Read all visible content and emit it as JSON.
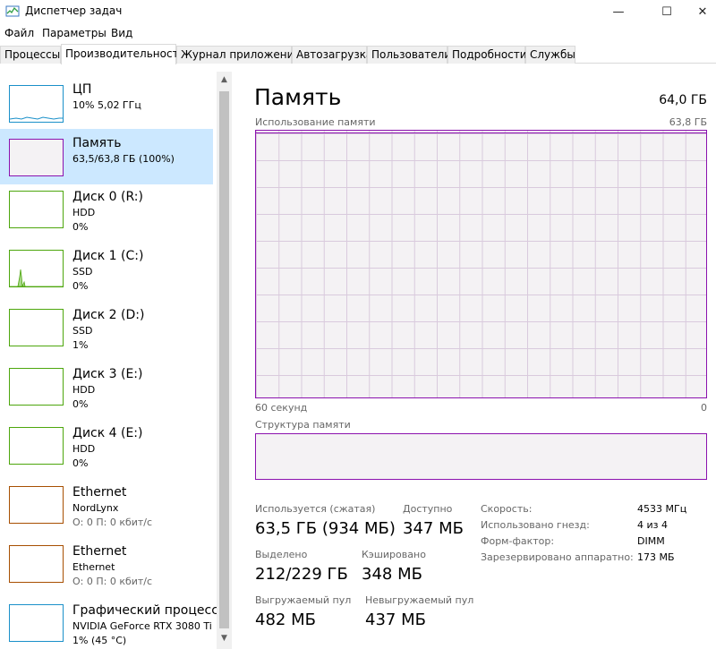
{
  "window": {
    "title": "Диспетчер задач",
    "controls": {
      "minimize": "—",
      "maximize": "☐",
      "close": "✕"
    }
  },
  "menu": [
    "Файл",
    "Параметры",
    "Вид"
  ],
  "tabs": [
    {
      "label": "Процессы",
      "active": false
    },
    {
      "label": "Производительность",
      "active": true
    },
    {
      "label": "Журнал приложений",
      "active": false
    },
    {
      "label": "Автозагрузка",
      "active": false
    },
    {
      "label": "Пользователи",
      "active": false
    },
    {
      "label": "Подробности",
      "active": false
    },
    {
      "label": "Службы",
      "active": false
    }
  ],
  "sidebar": {
    "items": [
      {
        "name": "ЦП",
        "line1": "10%  5,02 ГГц",
        "line2": "",
        "color": "#1a90c9",
        "selected": false
      },
      {
        "name": "Память",
        "line1": "63,5/63,8 ГБ (100%)",
        "line2": "",
        "color": "#8b12ae",
        "selected": true
      },
      {
        "name": "Диск 0 (R:)",
        "line1": "HDD",
        "line2": "0%",
        "color": "#4da60c",
        "selected": false
      },
      {
        "name": "Диск 1 (C:)",
        "line1": "SSD",
        "line2": "0%",
        "color": "#4da60c",
        "selected": false
      },
      {
        "name": "Диск 2 (D:)",
        "line1": "SSD",
        "line2": "1%",
        "color": "#4da60c",
        "selected": false
      },
      {
        "name": "Диск 3 (E:)",
        "line1": "HDD",
        "line2": "0%",
        "color": "#4da60c",
        "selected": false
      },
      {
        "name": "Диск 4 (E:)",
        "line1": "HDD",
        "line2": "0%",
        "color": "#4da60c",
        "selected": false
      },
      {
        "name": "Ethernet",
        "line1": "NordLynx",
        "line2": "О: 0 П: 0 кбит/с",
        "color": "#a74f01",
        "selected": false
      },
      {
        "name": "Ethernet",
        "line1": "Ethernet",
        "line2": "О: 0 П: 0 кбит/с",
        "color": "#a74f01",
        "selected": false
      },
      {
        "name": "Графический процессор",
        "line1": "NVIDIA GeForce RTX 3080 Ti",
        "line2": "1% (45 °C)",
        "color": "#1a90c9",
        "selected": false
      }
    ]
  },
  "main": {
    "title": "Память",
    "total": "64,0 ГБ",
    "usage_label": "Использование памяти",
    "usage_max": "63,8 ГБ",
    "time_left": "60 секунд",
    "time_right": "0",
    "structure_label": "Структура памяти",
    "accent": "#8b12ae",
    "stats": {
      "in_use_label": "Используется (сжатая)",
      "in_use_value": "63,5 ГБ (934 МБ)",
      "available_label": "Доступно",
      "available_value": "347 МБ",
      "committed_label": "Выделено",
      "committed_value": "212/229 ГБ",
      "cached_label": "Кэшировано",
      "cached_value": "348 МБ",
      "paged_label": "Выгружаемый пул",
      "paged_value": "482 МБ",
      "nonpaged_label": "Невыгружаемый пул",
      "nonpaged_value": "437 МБ"
    },
    "details": [
      {
        "label": "Скорость:",
        "value": "4533 МГц"
      },
      {
        "label": "Использовано гнезд:",
        "value": "4 из 4"
      },
      {
        "label": "Форм-фактор:",
        "value": "DIMM"
      },
      {
        "label": "Зарезервировано аппаратно:",
        "value": "173 МБ"
      }
    ]
  }
}
